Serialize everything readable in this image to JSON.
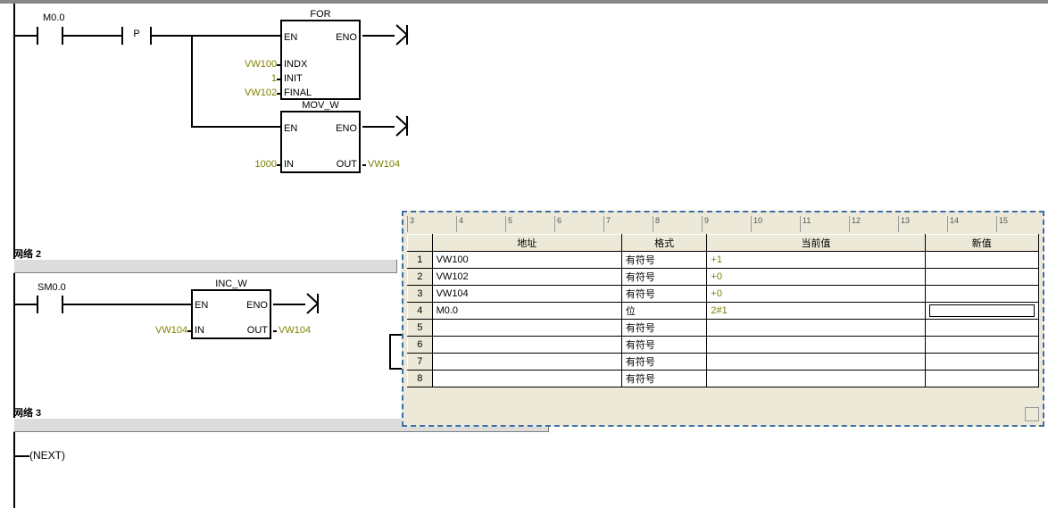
{
  "network1": {
    "contact1_label": "M0.0",
    "pbox_label": "P",
    "for_block": {
      "title": "FOR",
      "EN": "EN",
      "ENO": "ENO",
      "INDX": "INDX",
      "INDX_in": "VW100",
      "INIT": "INIT",
      "INIT_in": "1",
      "FINAL": "FINAL",
      "FINAL_in": "VW102"
    },
    "mov_block": {
      "title": "MOV_W",
      "EN": "EN",
      "ENO": "ENO",
      "IN": "IN",
      "IN_in": "1000",
      "OUT": "OUT",
      "OUT_out": "VW104"
    }
  },
  "network2": {
    "title": "网络 2",
    "contact_label": "SM0.0",
    "inc_block": {
      "title": "INC_W",
      "EN": "EN",
      "ENO": "ENO",
      "IN": "IN",
      "IN_in": "VW104",
      "OUT": "OUT",
      "OUT_out": "VW104"
    }
  },
  "network3": {
    "title": "网络 3",
    "coil_label": "NEXT"
  },
  "watch": {
    "ruler_marks": [
      "3",
      "4",
      "5",
      "6",
      "7",
      "8",
      "9",
      "10",
      "11",
      "12",
      "13",
      "14",
      "15"
    ],
    "headers": {
      "corner": "",
      "addr": "地址",
      "fmt": "格式",
      "val": "当前值",
      "newval": "新值"
    },
    "rows": [
      {
        "n": "1",
        "addr": "VW100",
        "fmt": "有符号",
        "val": "+1",
        "newval": ""
      },
      {
        "n": "2",
        "addr": "VW102",
        "fmt": "有符号",
        "val": "+0",
        "newval": ""
      },
      {
        "n": "3",
        "addr": "VW104",
        "fmt": "有符号",
        "val": "+0",
        "newval": ""
      },
      {
        "n": "4",
        "addr": "M0.0",
        "fmt": "位",
        "val": "2#1",
        "newval": "",
        "editing": true
      },
      {
        "n": "5",
        "addr": "",
        "fmt": "有符号",
        "val": "",
        "newval": ""
      },
      {
        "n": "6",
        "addr": "",
        "fmt": "有符号",
        "val": "",
        "newval": ""
      },
      {
        "n": "7",
        "addr": "",
        "fmt": "有符号",
        "val": "",
        "newval": ""
      },
      {
        "n": "8",
        "addr": "",
        "fmt": "有符号",
        "val": "",
        "newval": ""
      }
    ]
  }
}
